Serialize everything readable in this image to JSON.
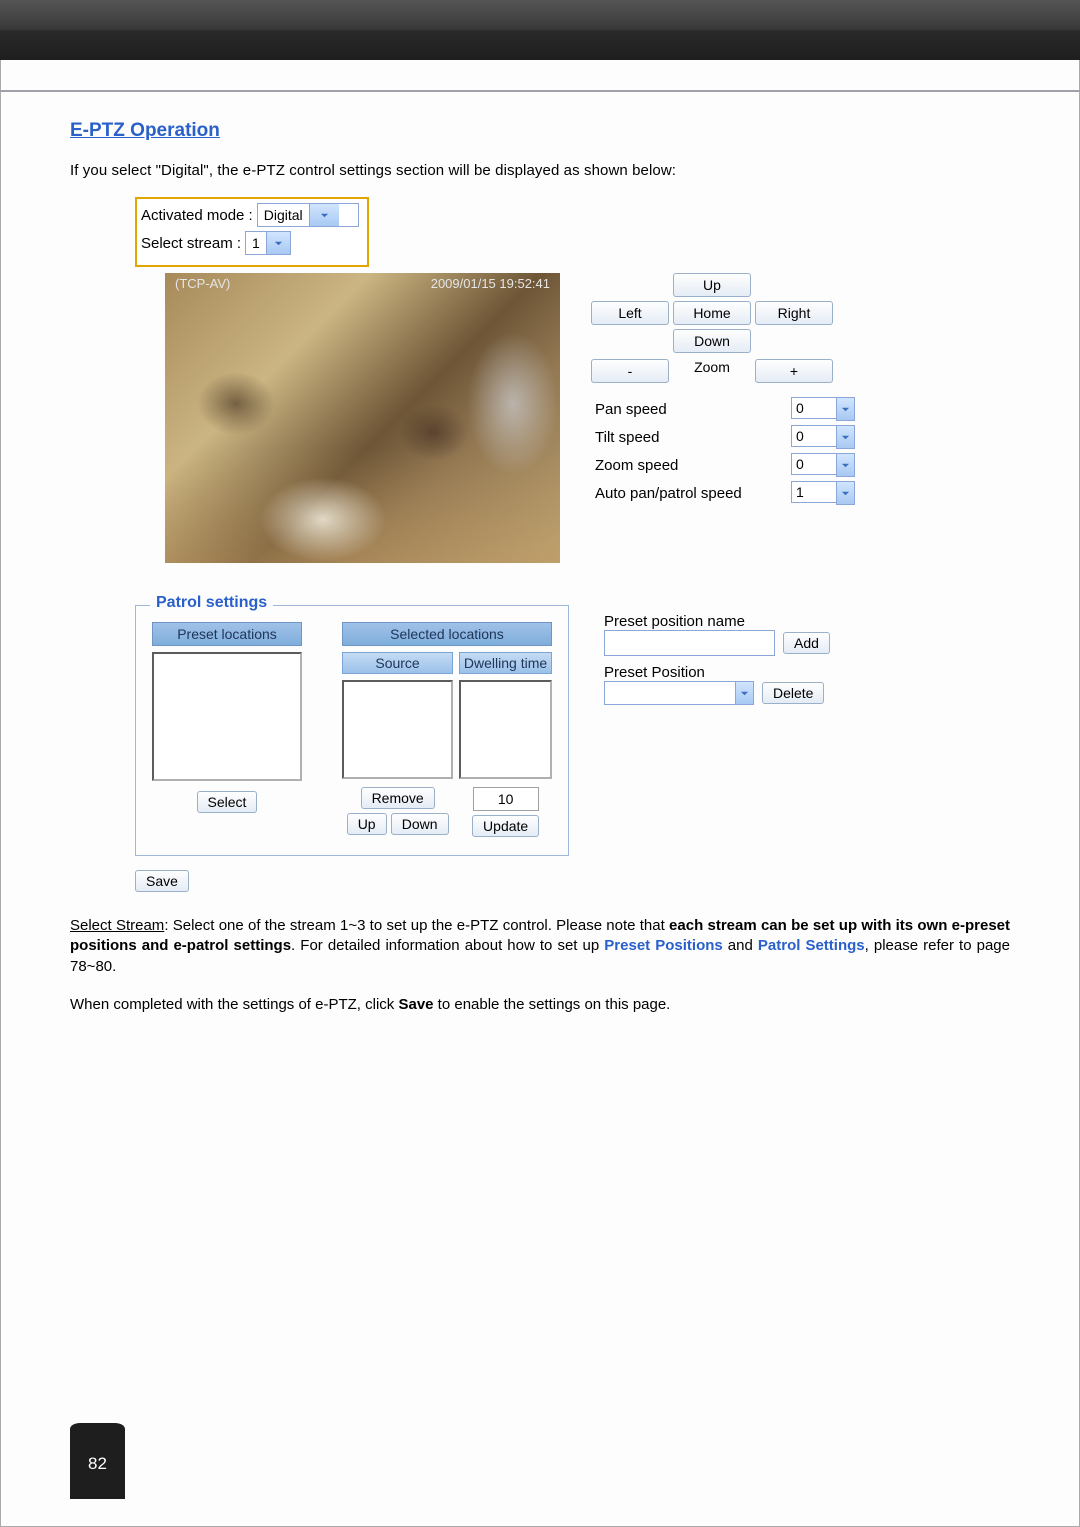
{
  "heading": "E-PTZ Operation",
  "intro": "If you select \"Digital\", the e-PTZ control settings section will be displayed as shown below:",
  "mode": {
    "label": "Activated mode :",
    "value": "Digital"
  },
  "stream": {
    "label": "Select stream :",
    "value": "1"
  },
  "video": {
    "overlay_left": "(TCP-AV)",
    "overlay_right": "2009/01/15 19:52:41"
  },
  "ptz": {
    "up": "Up",
    "down": "Down",
    "left": "Left",
    "right": "Right",
    "home": "Home",
    "zoom_label": "Zoom",
    "zoom_out": "-",
    "zoom_in": "+"
  },
  "speeds": {
    "pan_label": "Pan speed",
    "pan_val": "0",
    "tilt_label": "Tilt speed",
    "tilt_val": "0",
    "zoom_label": "Zoom speed",
    "zoom_val": "0",
    "auto_label": "Auto pan/patrol speed",
    "auto_val": "1"
  },
  "patrol": {
    "legend": "Patrol settings",
    "preset_hdr": "Preset locations",
    "selected_hdr": "Selected locations",
    "source_hdr": "Source",
    "dwell_hdr": "Dwelling time",
    "select_btn": "Select",
    "remove_btn": "Remove",
    "up_btn": "Up",
    "down_btn": "Down",
    "dwell_val": "10",
    "update_btn": "Update"
  },
  "preset_panel": {
    "name_label": "Preset position name",
    "add_btn": "Add",
    "pos_label": "Preset Position",
    "delete_btn": "Delete"
  },
  "save_btn": "Save",
  "body": {
    "p1a": "Select Stream",
    "p1b": ": Select one of the stream 1~3 to set up the e-PTZ control. Please note that ",
    "p1c": "each stream can be set up with its own e-preset positions and e-patrol settings",
    "p1d": ". For detailed information about how to set up ",
    "link1": "Preset Positions",
    "p1e": " and ",
    "link2": "Patrol Settings",
    "p1f": ", please refer to page 78~80.",
    "p2a": "When completed with the settings of e-PTZ, click ",
    "p2b": "Save",
    "p2c": " to enable the settings on this page."
  },
  "page_number": "82"
}
